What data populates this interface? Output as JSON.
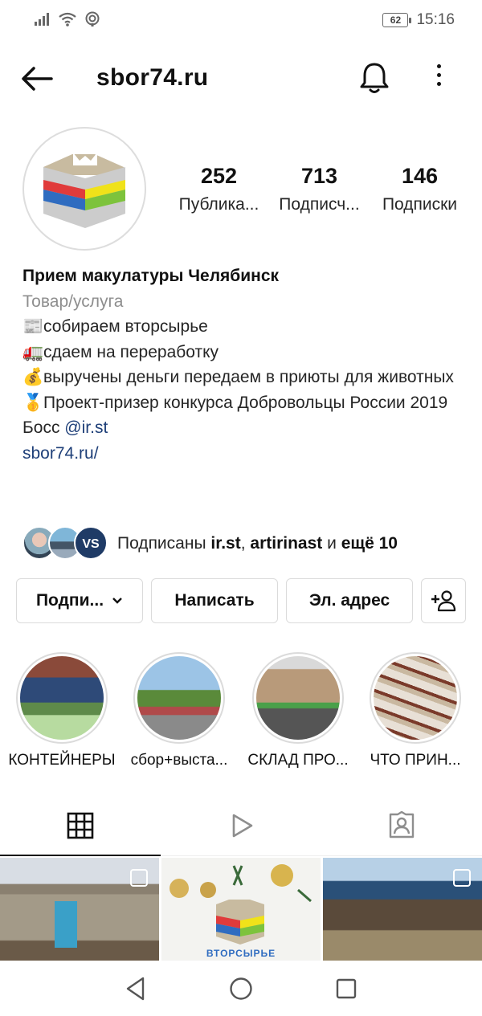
{
  "status_bar": {
    "battery": "62",
    "time": "15:16"
  },
  "header": {
    "username": "sbor74.ru"
  },
  "stats": [
    {
      "value": "252",
      "label": "Публика..."
    },
    {
      "value": "713",
      "label": "Подписч..."
    },
    {
      "value": "146",
      "label": "Подписки"
    }
  ],
  "bio": {
    "name": "Прием макулатуры Челябинск",
    "category": "Товар/услуга",
    "line1_emoji": "📰",
    "line1": "собираем вторсырье",
    "line2_emoji": "🚛",
    "line2": "сдаем на переработку",
    "line3_emoji": "💰",
    "line3": "выручены деньги передаем в приюты для животных",
    "line4_emoji": "🥇",
    "line4": "Проект-призер конкурса Добровольцы России 2019",
    "boss_prefix": "Босс ",
    "boss_handle": "@ir.st",
    "website": "sbor74.ru/"
  },
  "followed_by": {
    "prefix": "Подписаны ",
    "user1": "ir.st",
    "sep": ", ",
    "user2": "artirinast",
    "and": " и ",
    "more": "ещё 10"
  },
  "actions": {
    "follow": "Подпи...",
    "message": "Написать",
    "email": "Эл. адрес"
  },
  "highlights": [
    {
      "label": "КОНТЕЙНЕРЫ"
    },
    {
      "label": "сбор+выста..."
    },
    {
      "label": "СКЛАД ПРО..."
    },
    {
      "label": "ЧТО ПРИН..."
    }
  ],
  "posts": [
    {
      "caption": ""
    },
    {
      "caption": "ВТОРСЫРЬЕ"
    },
    {
      "caption": ""
    }
  ],
  "colors": {
    "link": "#1e3f78",
    "muted": "#8e8e8e",
    "border": "#dbdbdb"
  }
}
